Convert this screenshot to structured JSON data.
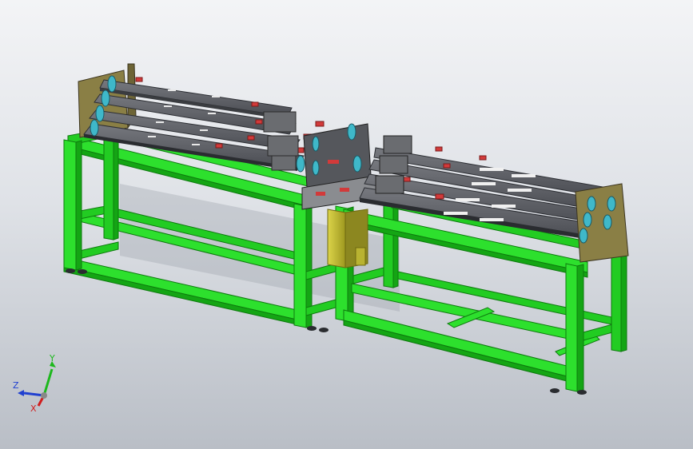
{
  "view": {
    "background_top": "#f3f4f6",
    "background_bottom": "#b9bec6"
  },
  "model": {
    "frame_color": "#22dd22",
    "frame_dark": "#139c13",
    "plate_color": "#5e6066",
    "plate_dark": "#3a3c40",
    "accent_cyan": "#3fb8c9",
    "accent_red": "#d23a3a",
    "post_color": "#c8c030"
  },
  "triad": {
    "x_label": "X",
    "y_label": "Y",
    "z_label": "Z",
    "x_color": "#d11c1c",
    "y_color": "#1cb81c",
    "z_color": "#2040d0"
  }
}
